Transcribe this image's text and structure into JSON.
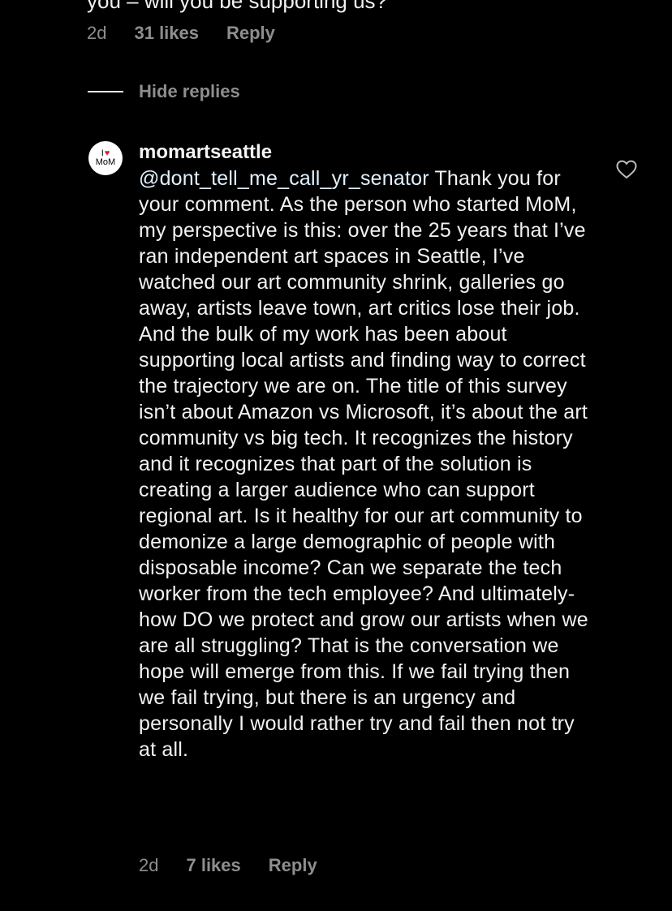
{
  "previous_comment": {
    "partial_text": "you – will you be supporting us?",
    "time": "2d",
    "likes": "31 likes",
    "reply_label": "Reply"
  },
  "hide_replies_label": "Hide replies",
  "reply_comment": {
    "avatar": {
      "logo_line1": "I",
      "logo_heart": "♥",
      "logo_line2": "MoM"
    },
    "username": "momartseattle",
    "mention": "@dont_tell_me_call_yr_senator",
    "text": " Thank you for your comment. As the person who started MoM, my perspective is this: over the 25 years that I’ve ran independent art spaces in Seattle, I’ve watched our art community shrink, galleries go away, artists leave town, art critics lose their job. And the bulk of my work has been about supporting local artists and finding way to correct the trajectory we are on. The title of this survey isn’t about Amazon vs Microsoft, it’s about the art community vs big tech. It recognizes the history and it recognizes that part of the solution is creating a larger audience who can support regional art. Is it healthy for our art community to demonize a large demographic of people with disposable income? Can we separate the tech worker from the tech employee? And ultimately- how DO we protect and grow our artists when we are all struggling? That is the conversation we hope will emerge from this. If we fail trying then we fail trying, but there is an urgency and personally I would rather try and fail then not try at all.",
    "time": "2d",
    "likes": "7 likes",
    "reply_label": "Reply",
    "like_icon": "heart-outline-icon"
  },
  "colors": {
    "background": "#000000",
    "text": "#f5f5f5",
    "secondary": "#8e8e8e",
    "mention": "#e0f1ff",
    "logo_heart": "#e0202a"
  }
}
